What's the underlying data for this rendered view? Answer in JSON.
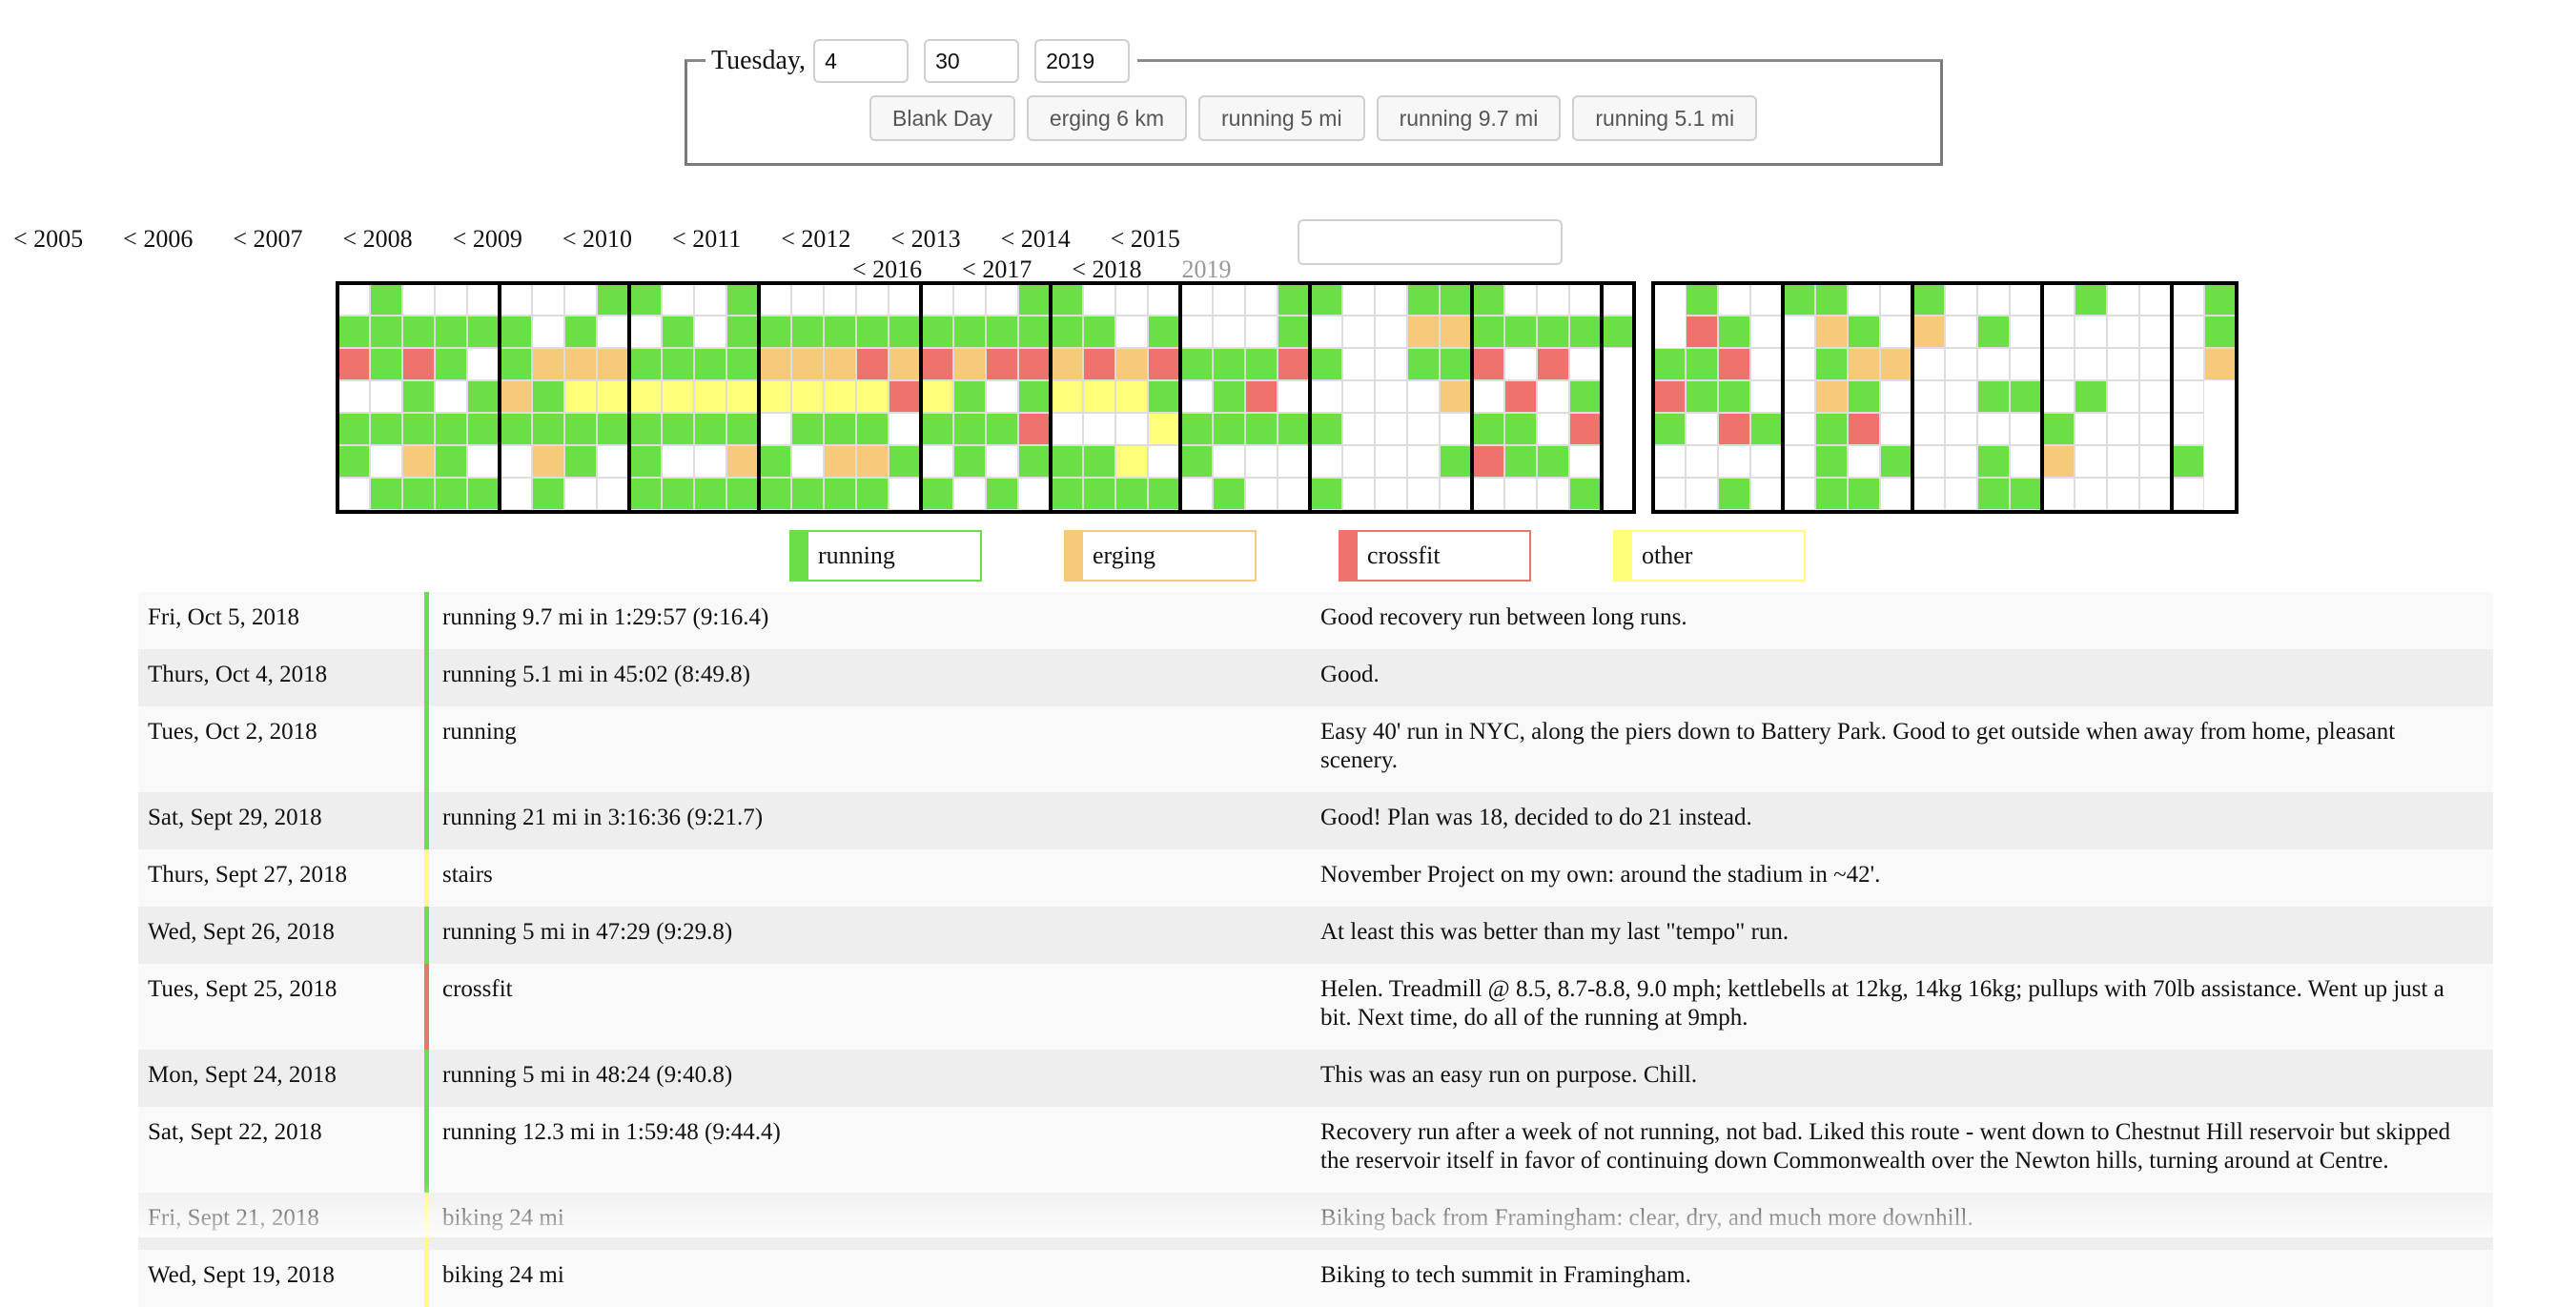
{
  "entry": {
    "weekday": "Tuesday,",
    "month": "4",
    "day": "30",
    "year": "2019",
    "quick_buttons": [
      "Blank Day",
      "erging 6 km",
      "running 5 mi",
      "running 9.7 mi",
      "running 5.1 mi"
    ]
  },
  "years": {
    "row1": [
      "< 2005",
      "< 2006",
      "< 2007",
      "< 2008",
      "< 2009",
      "< 2010",
      "< 2011",
      "< 2012",
      "< 2013",
      "< 2014",
      "< 2015"
    ],
    "row2": [
      "< 2016",
      "< 2017",
      "< 2018"
    ],
    "current": "2019"
  },
  "search": {
    "value": "",
    "placeholder": ""
  },
  "colors": {
    "running": "#6ae044",
    "erging": "#f6ca7a",
    "crossfit": "#ee736d",
    "other": "#ffff7a",
    "empty": "#ffffff",
    "gridline": "#dddddd"
  },
  "calendar": {
    "legend_codes": {
      "W": "empty",
      "G": "running",
      "E": "erging",
      "C": "crossfit",
      "Y": "other",
      "-": "none"
    },
    "block1_columns": [
      "WGCWGGW",
      "GGGWGWG",
      "WGCGGEG",
      "WGGWGGG",
      "WGWGGWG",
      "WGGEGWW",
      "WWEGGEG",
      "WGEYGGW",
      "GWEYGWW",
      "GWGYGGG",
      "WGGYGWG",
      "WWGYGWG",
      "GGGYGEG",
      "WGEYWGG",
      "WGEYGWG",
      "WGEYGEG",
      "WGCYGEG",
      "WGECWGW",
      "WGCYGWG",
      "WGEGGGW",
      "WGCWGWG",
      "GGCGCGW",
      "GGEYWGG",
      "WGCYWGG",
      "WWEYWYG",
      "WGCGYWG",
      "WWGWGGW",
      "WWGGGWG",
      "WWGCGWW",
      "GGCWGWW",
      "GWGWGWG",
      "WWWWWWW",
      "WWWWWWW",
      "GEGWWWW",
      "GEGEWGW",
      "GGCWGCW",
      "WGWCGGW",
      "WGCWWGW",
      "WGWGCWG",
      "WG-----"
    ],
    "block2_columns": [
      "--GCGWW",
      "GCGGWWW",
      "WGCGCWG",
      "WWWWGWW",
      "GWWWWWW",
      "GEGEGGG",
      "WGEGCWG",
      "WWEWWGW",
      "GEWWWWW",
      "WWWWWWW",
      "WGWGWGG",
      "WWWGWWG",
      "WWWWGEW",
      "GWWGWWW",
      "WWWWWWW",
      "WWWWWWW",
      "WWWWWGW",
      "GGE----"
    ]
  },
  "legend": [
    {
      "label": "running",
      "key": "running"
    },
    {
      "label": "erging",
      "key": "erging"
    },
    {
      "label": "crossfit",
      "key": "crossfit"
    },
    {
      "label": "other",
      "key": "other"
    }
  ],
  "log": [
    {
      "date": "Fri, Oct 5, 2018",
      "activity": "running 9.7 mi in 1:29:57 (9:16.4)",
      "type": "running",
      "note": "Good recovery run between long runs."
    },
    {
      "date": "Thurs, Oct 4, 2018",
      "activity": "running 5.1 mi in 45:02 (8:49.8)",
      "type": "running",
      "note": "Good."
    },
    {
      "date": "Tues, Oct 2, 2018",
      "activity": "running",
      "type": "running",
      "note": "Easy 40' run in NYC, along the piers down to Battery Park. Good to get outside when away from home, pleasant scenery."
    },
    {
      "date": "Sat, Sept 29, 2018",
      "activity": "running 21 mi in 3:16:36 (9:21.7)",
      "type": "running",
      "note": "Good! Plan was 18, decided to do 21 instead."
    },
    {
      "date": "Thurs, Sept 27, 2018",
      "activity": "stairs",
      "type": "other",
      "note": "November Project on my own: around the stadium in ~42'."
    },
    {
      "date": "Wed, Sept 26, 2018",
      "activity": "running 5 mi in 47:29 (9:29.8)",
      "type": "running",
      "note": "At least this was better than my last \"tempo\" run."
    },
    {
      "date": "Tues, Sept 25, 2018",
      "activity": "crossfit",
      "type": "crossfit",
      "note": "Helen. Treadmill @ 8.5, 8.7-8.8, 9.0 mph; kettlebells at 12kg, 14kg 16kg; pullups with 70lb assistance. Went up just a bit. Next time, do all of the running at 9mph."
    },
    {
      "date": "Mon, Sept 24, 2018",
      "activity": "running 5 mi in 48:24 (9:40.8)",
      "type": "running",
      "note": "This was an easy run on purpose. Chill."
    },
    {
      "date": "Sat, Sept 22, 2018",
      "activity": "running 12.3 mi in 1:59:48 (9:44.4)",
      "type": "running",
      "note": "Recovery run after a week of not running, not bad. Liked this route - went down to Chestnut Hill reservoir but skipped the reservoir itself in favor of continuing down Commonwealth over the Newton hills, turning around at Centre."
    },
    {
      "date": "Fri, Sept 21, 2018",
      "activity": "biking 24 mi",
      "type": "other",
      "note": "Biking back from Framingham: clear, dry, and much more downhill."
    },
    {
      "date": "Wed, Sept 19, 2018",
      "activity": "biking 24 mi",
      "type": "other",
      "note": "Biking to tech summit in Framingham."
    }
  ]
}
